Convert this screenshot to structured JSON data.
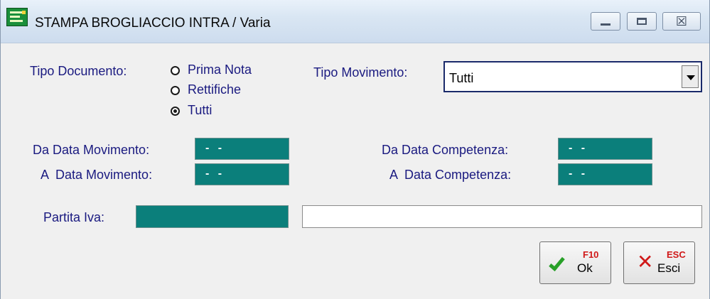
{
  "window": {
    "title": "STAMPA BROGLIACCIO INTRA / Varia",
    "controls": {
      "minimize_icon": "minimize-icon",
      "maximize_icon": "maximize-icon",
      "close_glyph": "☒"
    }
  },
  "tipo_documento": {
    "label": "Tipo Documento:",
    "options": [
      {
        "label": "Prima Nota",
        "selected": false
      },
      {
        "label": "Rettifiche",
        "selected": false
      },
      {
        "label": "Tutti",
        "selected": true
      }
    ]
  },
  "tipo_movimento": {
    "label": "Tipo Movimento:",
    "value": "Tutti"
  },
  "da_data_movimento": {
    "label": "Da Data Movimento:",
    "value": "- -"
  },
  "a_data_movimento": {
    "label": "A  Data Movimento:",
    "value": "- -"
  },
  "da_data_competenza": {
    "label": "Da Data Competenza:",
    "value": "- -"
  },
  "a_data_competenza": {
    "label": "A  Data Competenza:",
    "value": "- -"
  },
  "partita_iva": {
    "label": "Partita Iva:",
    "code": "",
    "description": ""
  },
  "buttons": {
    "ok": {
      "label": "Ok",
      "key": "F10"
    },
    "esci": {
      "label": "Esci",
      "key": "ESC"
    }
  },
  "colors": {
    "field_teal": "#0b7f7b",
    "label_blue": "#1a1a80",
    "ok_green": "#28a028",
    "esc_red": "#d01818"
  }
}
